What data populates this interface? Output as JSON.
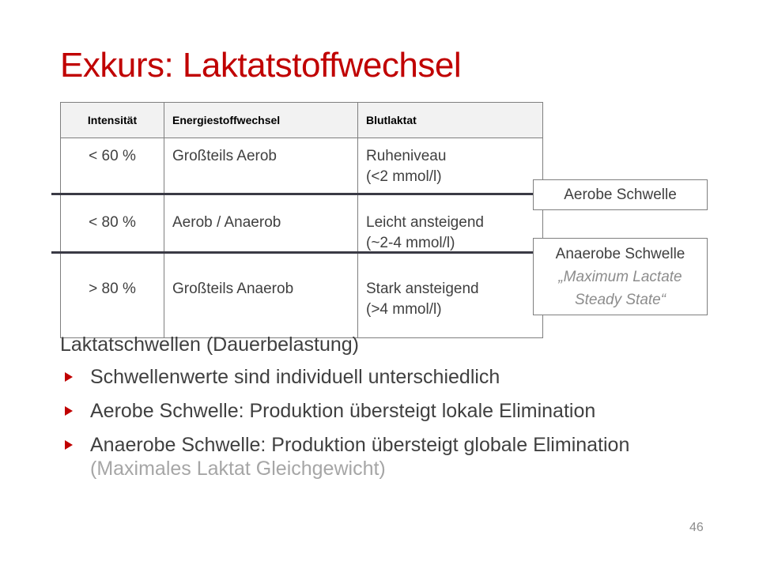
{
  "slide": {
    "title": "Exkurs: Laktatstoffwechsel",
    "page_number": "46"
  },
  "table": {
    "headers": [
      "Intensität",
      "Energiestoffwechsel",
      "Blutlaktat"
    ],
    "rows": [
      [
        "< 60 %",
        "Großteils Aerob",
        "Ruheniveau\n(<2 mmol/l)"
      ],
      [
        "< 80 %",
        "Aerob / Anaerob",
        "Leicht ansteigend\n(~2-4 mmol/l)"
      ],
      [
        "> 80 %",
        "Großteils Anaerob",
        "Stark ansteigend\n(>4 mmol/l)"
      ]
    ]
  },
  "callouts": {
    "aerobic": "Aerobe Schwelle",
    "anaerobic": "Anaerobe Schwelle",
    "anaerobic_sub": "„Maximum Lactate Steady State“"
  },
  "content": {
    "heading": "Laktatschwellen (Dauerbelastung)",
    "bullets": [
      "Schwellenwerte sind individuell unterschiedlich",
      "Aerobe Schwelle: Produktion übersteigt lokale Elimination",
      "Anaerobe Schwelle: Produktion übersteigt globale Elimination"
    ],
    "bullet_note": "(Maximales Laktat Gleichgewicht)"
  },
  "colors": {
    "accent": "#c00000",
    "text": "#404040",
    "muted": "#a6a6a6"
  }
}
